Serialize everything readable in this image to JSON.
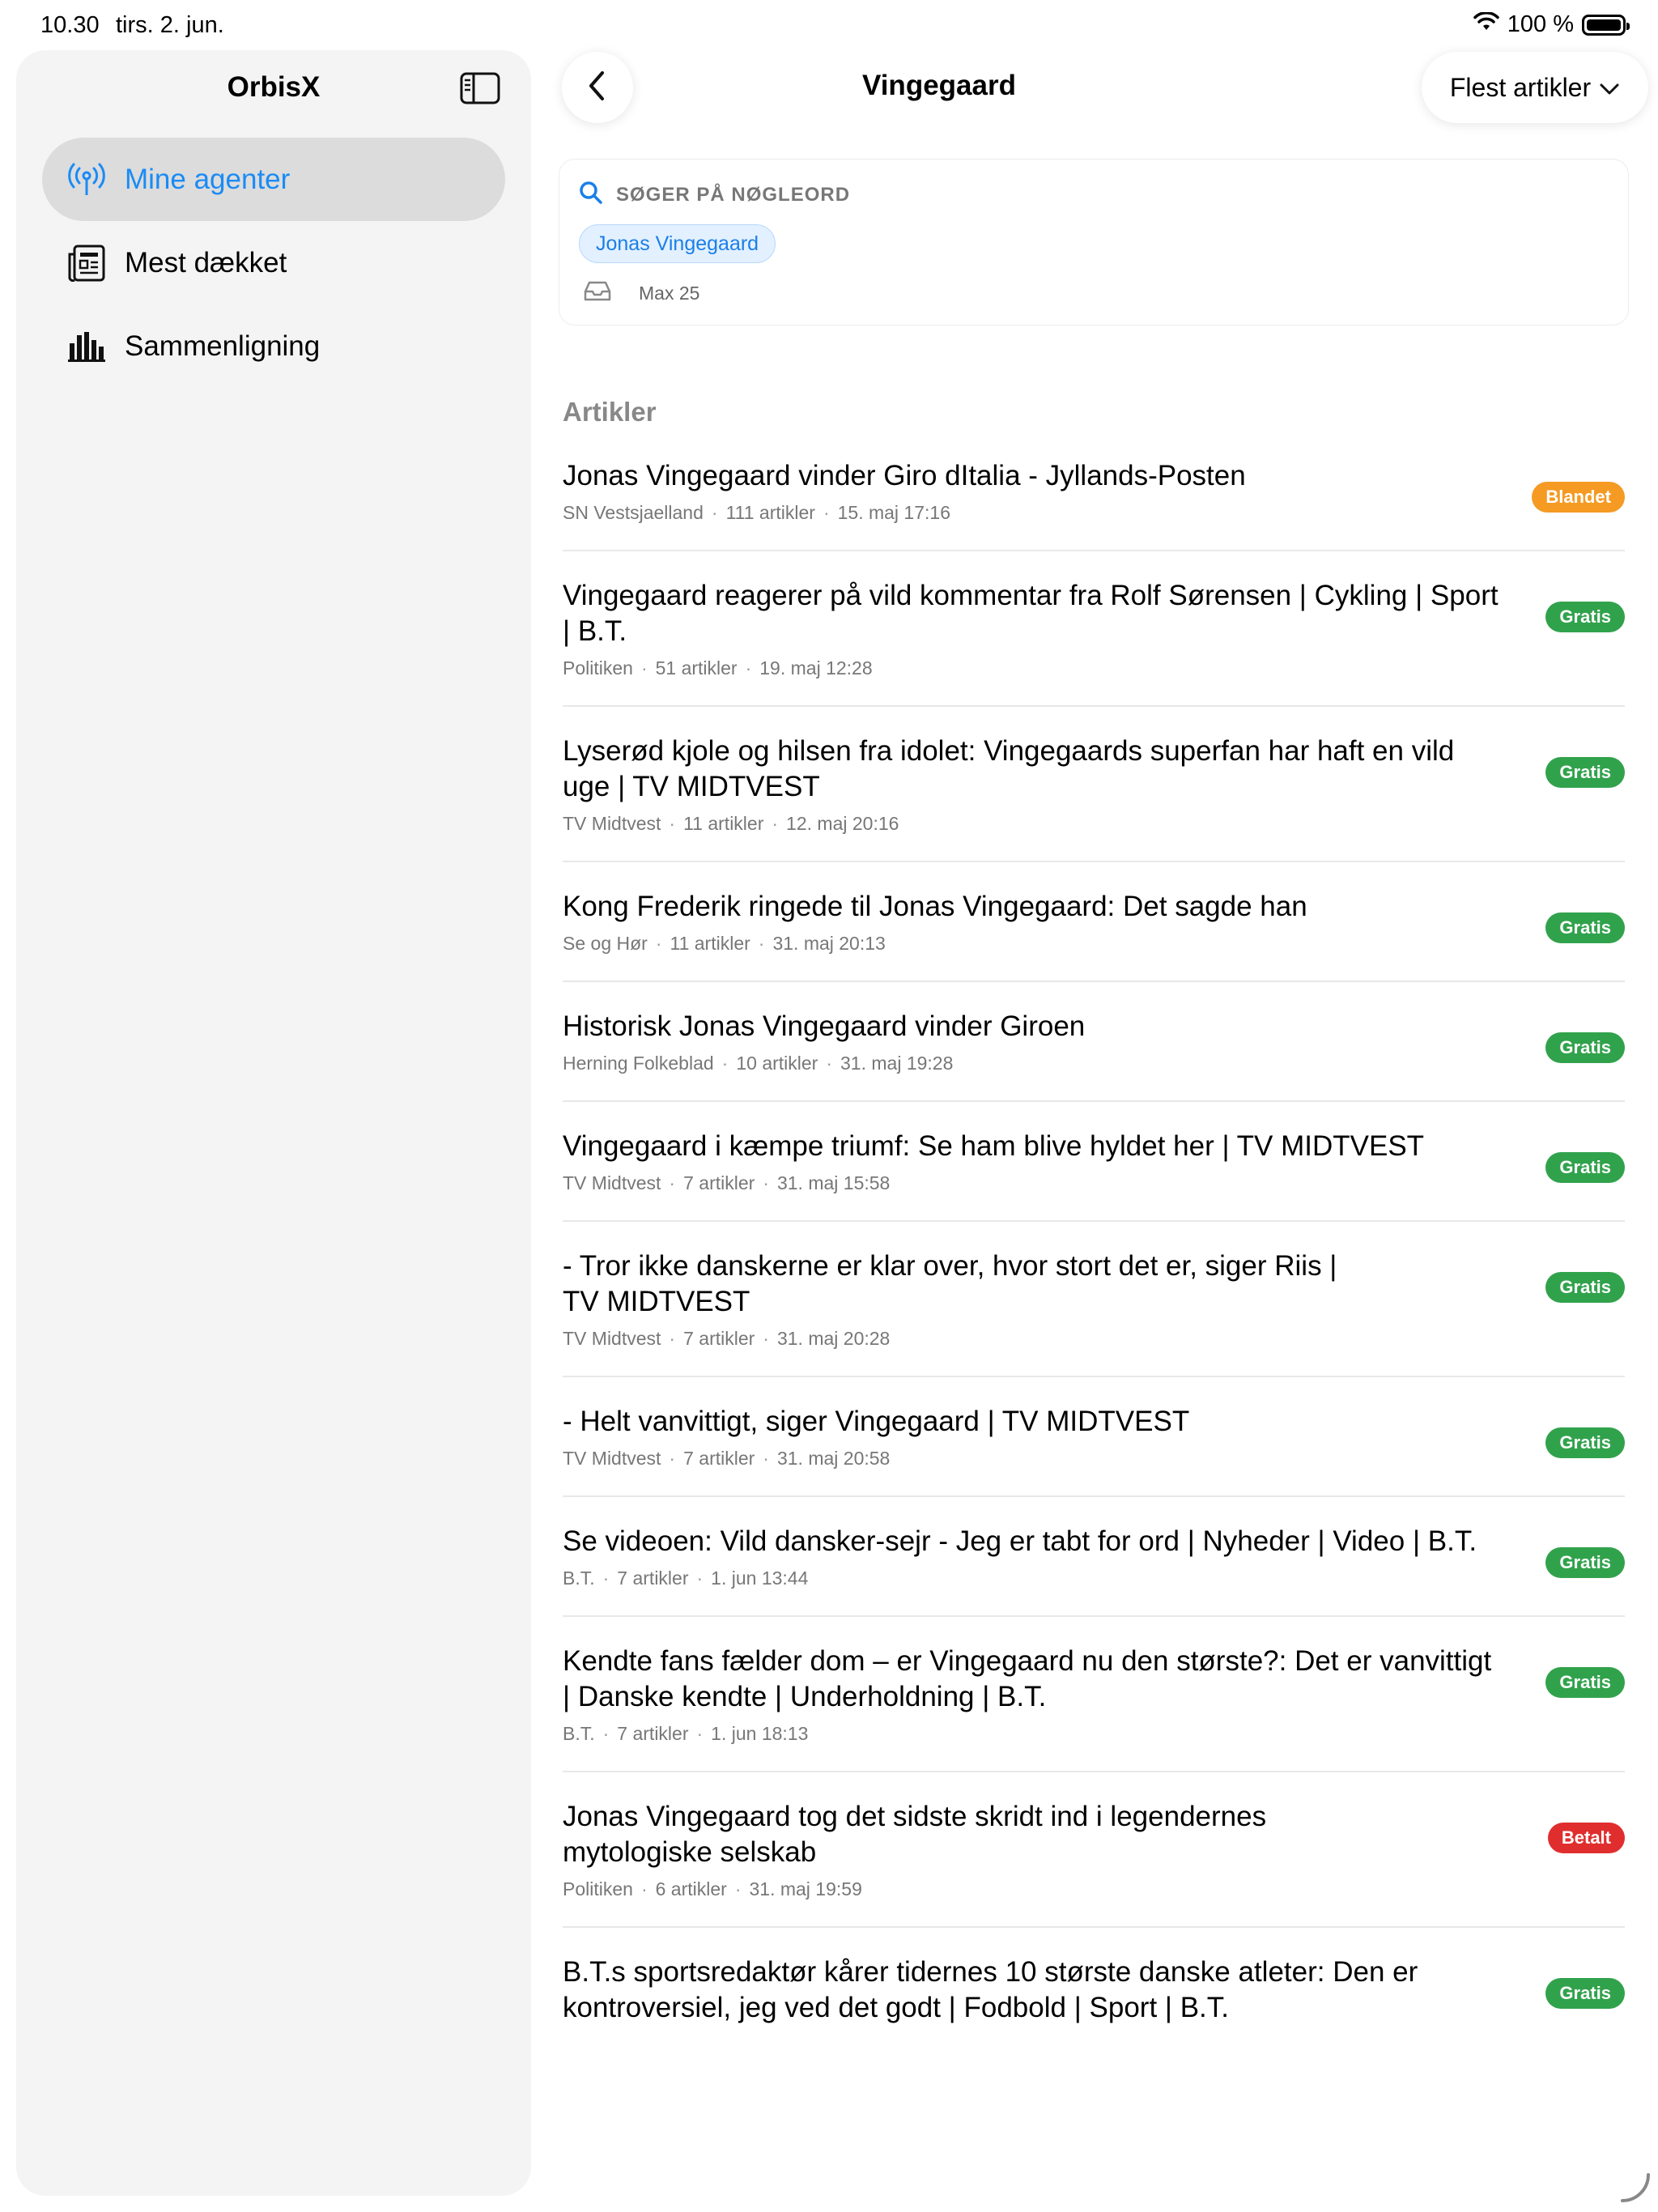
{
  "status_bar": {
    "time": "10.30",
    "date": "tirs. 2. jun.",
    "battery": "100 %"
  },
  "sidebar": {
    "title": "OrbisX",
    "items": [
      {
        "label": "Mine agenter",
        "icon": "antenna-icon",
        "active": true
      },
      {
        "label": "Mest dækket",
        "icon": "newspaper-icon",
        "active": false
      },
      {
        "label": "Sammenligning",
        "icon": "bar-chart-icon",
        "active": false
      }
    ]
  },
  "header": {
    "title": "Vingegaard",
    "sort_label": "Flest artikler"
  },
  "search": {
    "label": "SØGER PÅ NØGLEORD",
    "keyword": "Jonas Vingegaard",
    "max": "Max 25"
  },
  "articles": {
    "section_title": "Artikler",
    "items": [
      {
        "title": "Jonas Vingegaard vinder Giro dItalia - Jyllands-Posten",
        "source": "SN Vestsjaelland",
        "count": "111 artikler",
        "date": "15. maj 17:16",
        "badge": "Blandet",
        "badge_color": "#f59a23"
      },
      {
        "title": "Vingegaard reagerer på vild kommentar fra Rolf Sørensen | Cykling | Sport | B.T.",
        "source": "Politiken",
        "count": "51 artikler",
        "date": "19. maj 12:28",
        "badge": "Gratis",
        "badge_color": "#31a24c"
      },
      {
        "title": "Lyserød kjole og hilsen fra idolet: Vingegaards superfan har haft en vild uge | TV MIDTVEST",
        "source": "TV Midtvest",
        "count": "11 artikler",
        "date": "12. maj 20:16",
        "badge": "Gratis",
        "badge_color": "#31a24c"
      },
      {
        "title": "Kong Frederik ringede til Jonas Vingegaard: Det sagde han",
        "source": "Se og Hør",
        "count": "11 artikler",
        "date": "31. maj 20:13",
        "badge": "Gratis",
        "badge_color": "#31a24c"
      },
      {
        "title": "Historisk Jonas Vingegaard vinder Giroen",
        "source": "Herning Folkeblad",
        "count": "10 artikler",
        "date": "31. maj 19:28",
        "badge": "Gratis",
        "badge_color": "#31a24c"
      },
      {
        "title": "Vingegaard i kæmpe triumf: Se ham blive hyldet her | TV MIDTVEST",
        "source": "TV Midtvest",
        "count": "7 artikler",
        "date": "31. maj 15:58",
        "badge": "Gratis",
        "badge_color": "#31a24c"
      },
      {
        "title": "- Tror ikke danskerne er klar over, hvor stort det er, siger Riis | TV MIDTVEST",
        "source": "TV Midtvest",
        "count": "7 artikler",
        "date": "31. maj 20:28",
        "badge": "Gratis",
        "badge_color": "#31a24c"
      },
      {
        "title": "- Helt vanvittigt, siger Vingegaard | TV MIDTVEST",
        "source": "TV Midtvest",
        "count": "7 artikler",
        "date": "31. maj 20:58",
        "badge": "Gratis",
        "badge_color": "#31a24c"
      },
      {
        "title": "Se videoen: Vild dansker-sejr - Jeg er tabt for ord | Nyheder | Video | B.T.",
        "source": "B.T.",
        "count": "7 artikler",
        "date": "1. jun 13:44",
        "badge": "Gratis",
        "badge_color": "#31a24c"
      },
      {
        "title": "Kendte fans fælder dom – er Vingegaard nu den største?: Det er vanvittigt | Danske kendte | Underholdning | B.T.",
        "source": "B.T.",
        "count": "7 artikler",
        "date": "1. jun 18:13",
        "badge": "Gratis",
        "badge_color": "#31a24c"
      },
      {
        "title": "Jonas Vingegaard tog det sidste skridt ind i legendernes mytologiske selskab",
        "source": "Politiken",
        "count": "6 artikler",
        "date": "31. maj 19:59",
        "badge": "Betalt",
        "badge_color": "#e02e2e"
      },
      {
        "title": "B.T.s sportsredaktør kårer tidernes 10 største danske atleter: Den er kontroversiel, jeg ved det godt | Fodbold | Sport | B.T.",
        "source": "",
        "count": "",
        "date": "",
        "badge": "Gratis",
        "badge_color": "#31a24c"
      }
    ]
  }
}
